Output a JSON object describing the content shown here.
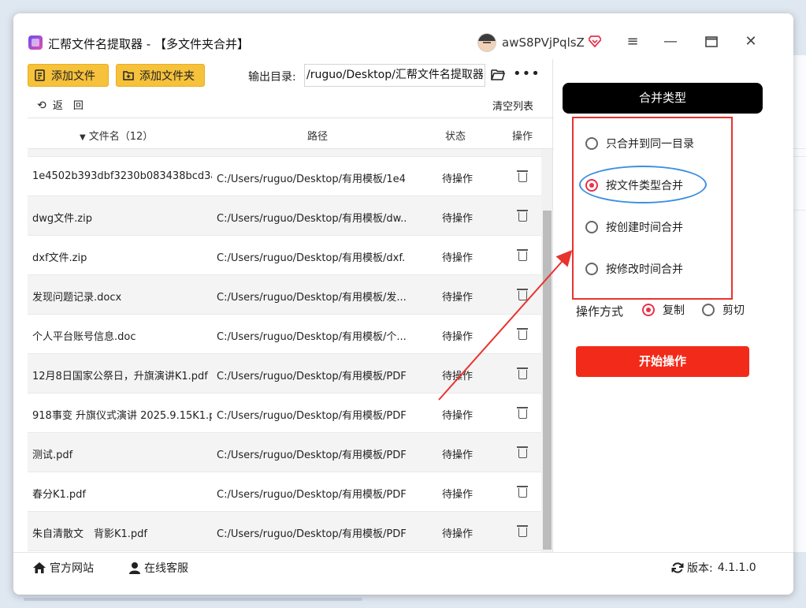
{
  "window": {
    "title": "汇帮文件名提取器 - 【多文件夹合并】",
    "username": "awS8PVjPqlsZ"
  },
  "toolbar": {
    "add_file": "添加文件",
    "add_folder": "添加文件夹",
    "output_label": "输出目录:",
    "output_path": "/ruguo/Desktop/汇帮文件名提取器",
    "back": "返　回",
    "clear_list": "清空列表"
  },
  "table": {
    "columns": {
      "name": "文件名（12）",
      "path": "路径",
      "status": "状态",
      "op": "操作"
    },
    "rows": [
      {
        "name": "1e4502b393dbf3230b083438bcd3ac...",
        "path": "C:/Users/ruguo/Desktop/有用模板/1e4...",
        "status": "待操作"
      },
      {
        "name": "dwg文件.zip",
        "path": "C:/Users/ruguo/Desktop/有用模板/dw...",
        "status": "待操作"
      },
      {
        "name": "dxf文件.zip",
        "path": "C:/Users/ruguo/Desktop/有用模板/dxf...",
        "status": "待操作"
      },
      {
        "name": "发现问题记录.docx",
        "path": "C:/Users/ruguo/Desktop/有用模板/发...",
        "status": "待操作"
      },
      {
        "name": "个人平台账号信息.doc",
        "path": "C:/Users/ruguo/Desktop/有用模板/个...",
        "status": "待操作"
      },
      {
        "name": "12月8日国家公祭日，升旗演讲K1.pdf",
        "path": "C:/Users/ruguo/Desktop/有用模板/PDF...",
        "status": "待操作"
      },
      {
        "name": "918事变 升旗仪式演讲 2025.9.15K1.pdf",
        "path": "C:/Users/ruguo/Desktop/有用模板/PDF...",
        "status": "待操作"
      },
      {
        "name": "测试.pdf",
        "path": "C:/Users/ruguo/Desktop/有用模板/PDF...",
        "status": "待操作"
      },
      {
        "name": "春分K1.pdf",
        "path": "C:/Users/ruguo/Desktop/有用模板/PDF...",
        "status": "待操作"
      },
      {
        "name": "朱自清散文　背影K1.pdf",
        "path": "C:/Users/ruguo/Desktop/有用模板/PDF...",
        "status": "待操作"
      }
    ]
  },
  "panel": {
    "merge_type_title": "合并类型",
    "options": [
      {
        "label": "只合并到同一目录",
        "selected": false
      },
      {
        "label": "按文件类型合并",
        "selected": true
      },
      {
        "label": "按创建时间合并",
        "selected": false
      },
      {
        "label": "按修改时间合并",
        "selected": false
      }
    ],
    "op_mode_label": "操作方式",
    "op_copy": "复制",
    "op_cut": "剪切",
    "op_selected": "复制",
    "start_button": "开始操作"
  },
  "footer": {
    "website": "官方网站",
    "service": "在线客服",
    "version_label": "版本:",
    "version": "4.1.1.0"
  },
  "background_fragments": [
    "讠",
    "门",
    "上",
    "文"
  ],
  "colors": {
    "accent_yellow": "#f6c13b",
    "start_red": "#f22a1a",
    "annotation_red": "#e8322e",
    "annotation_blue": "#3a8fe0",
    "radio_selected": "#e8324a"
  }
}
